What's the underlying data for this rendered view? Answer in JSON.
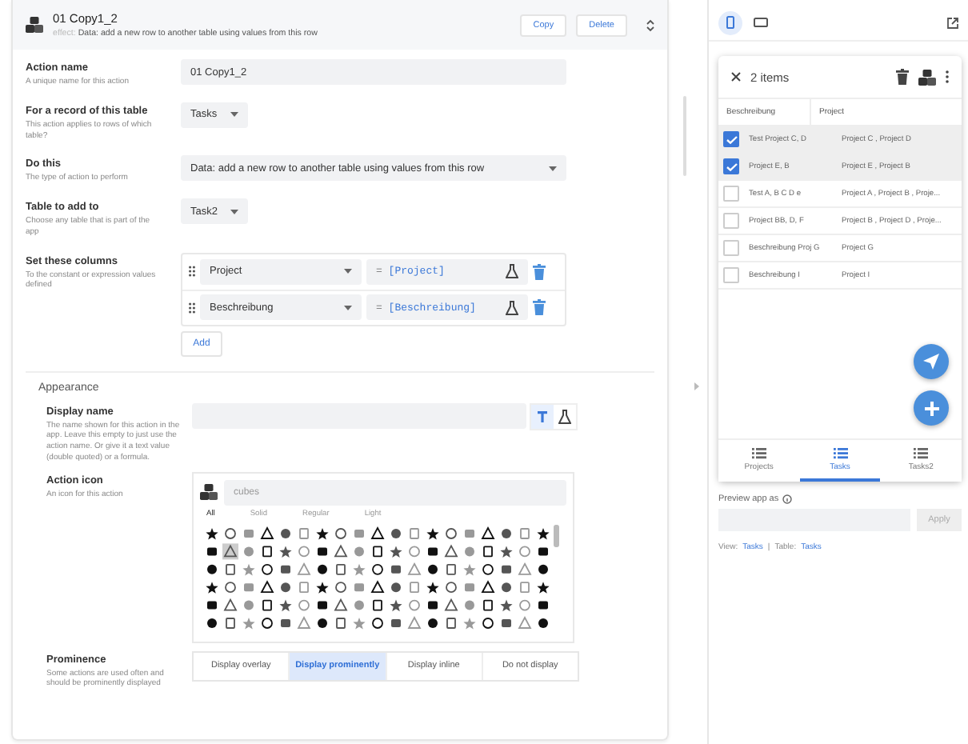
{
  "action_header": {
    "title": "01 Copy1_2",
    "effect_label": "effect:",
    "effect": "Data: add a new row to another table using values from this row",
    "buttons": [
      "Copy",
      "Delete"
    ]
  },
  "form": [
    {
      "kind": "text",
      "label": "Action name",
      "description": "A unique name for this action",
      "value": "01 Copy1_2"
    },
    {
      "kind": "select",
      "label": "For a record of this table",
      "description": "This action applies to rows of which table?",
      "value": "Tasks"
    },
    {
      "kind": "wide_select",
      "label": "Do this",
      "description": "The type of action to perform",
      "value": "Data: add a new row to another table using values from this row"
    },
    {
      "kind": "select",
      "label": "Table to add to",
      "description": "Choose any table that is part of the app",
      "value": "Task2"
    },
    {
      "kind": "columns",
      "label": "Set these columns",
      "description": "To the constant or expression values defined",
      "rows": [
        {
          "column": "Project",
          "expression": "= [Project]"
        },
        {
          "column": "Beschreibung",
          "expression": "= [Beschreibung]"
        }
      ],
      "add_button": "Add"
    }
  ],
  "appearance": {
    "heading": "Appearance",
    "display_name": {
      "label": "Display name",
      "description": "The name shown for this action in the app. Leave this empty to just use the action name. Or give it a text value (double quoted) or a formula.",
      "modes": [
        {
          "kind": "text",
          "selected": true
        },
        {
          "kind": "formula",
          "selected": false
        }
      ]
    },
    "action_icon": {
      "label": "Action icon",
      "description": "An icon for this action",
      "search": "cubes",
      "tabs": [
        {
          "label": "All",
          "selected": true
        },
        {
          "label": "Solid",
          "selected": false
        },
        {
          "label": "Regular",
          "selected": false
        },
        {
          "label": "Light",
          "selected": false
        }
      ]
    },
    "prominence": {
      "label": "Prominence",
      "description": "Some actions are used often and should be prominently displayed",
      "options": [
        {
          "label": "Display overlay",
          "selected": false
        },
        {
          "label": "Display prominently",
          "selected": true
        },
        {
          "label": "Display inline",
          "selected": false
        },
        {
          "label": "Do not display",
          "selected": false
        }
      ]
    }
  },
  "preview": {
    "devices": [
      {
        "kind": "phone",
        "selected": true
      },
      {
        "kind": "tablet",
        "selected": false
      }
    ],
    "app": {
      "title": "2 items",
      "columns": [
        "Beschreibung",
        "Project"
      ],
      "rows": [
        {
          "checked": true,
          "cells": [
            "Test Project C, D",
            "Project C , Project D"
          ]
        },
        {
          "checked": true,
          "cells": [
            "Project E, B",
            "Project E , Project B"
          ]
        },
        {
          "checked": false,
          "cells": [
            "Test A, B C D e",
            "Project A , Project B , Proje..."
          ]
        },
        {
          "checked": false,
          "cells": [
            "Project BB, D, F",
            "Project B , Project D , Proje..."
          ]
        },
        {
          "checked": false,
          "cells": [
            "Beschreibung Proj G",
            "Project G"
          ]
        },
        {
          "checked": false,
          "cells": [
            "Beschreibung I",
            "Project I"
          ]
        }
      ],
      "fabs": [
        {
          "kind": "send"
        },
        {
          "kind": "add"
        }
      ],
      "nav": [
        {
          "label": "Projects",
          "selected": false
        },
        {
          "label": "Tasks",
          "selected": true
        },
        {
          "label": "Tasks2",
          "selected": false
        }
      ]
    },
    "preview_as": {
      "label": "Preview app as",
      "apply": "Apply",
      "disabled": true
    },
    "footer": {
      "view_label": "View:",
      "view": "Tasks",
      "separator": "|",
      "table_label": "Table:",
      "table": "Tasks"
    }
  }
}
